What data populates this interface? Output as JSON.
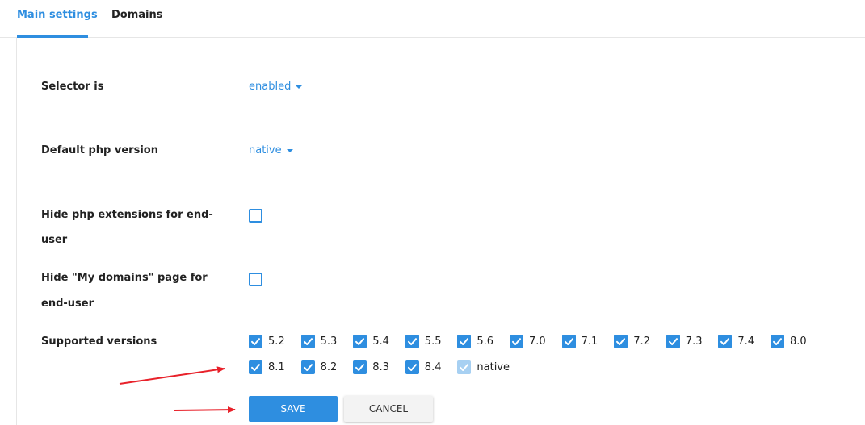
{
  "tabs": [
    {
      "label": "Main settings",
      "active": true
    },
    {
      "label": "Domains",
      "active": false
    }
  ],
  "settings": {
    "selector": {
      "label": "Selector is",
      "value": "enabled"
    },
    "default_php": {
      "label": "Default php version",
      "value": "native"
    },
    "hide_extensions": {
      "label_line1": "Hide php extensions for end-",
      "label_line2": "user",
      "checked": false
    },
    "hide_domains": {
      "label_line1": "Hide \"My domains\" page for",
      "label_line2": "end-user",
      "checked": false
    },
    "supported_versions": {
      "label": "Supported versions",
      "versions": [
        "5.2",
        "5.3",
        "5.4",
        "5.5",
        "5.6",
        "7.0",
        "7.1",
        "7.2",
        "7.3",
        "7.4",
        "8.0",
        "8.1",
        "8.2",
        "8.3",
        "8.4",
        "native"
      ],
      "native_disabled": true
    }
  },
  "buttons": {
    "save": "SAVE",
    "cancel": "CANCEL"
  },
  "colors": {
    "accent": "#2e8ee0",
    "annotation_arrow": "#e8212a"
  }
}
